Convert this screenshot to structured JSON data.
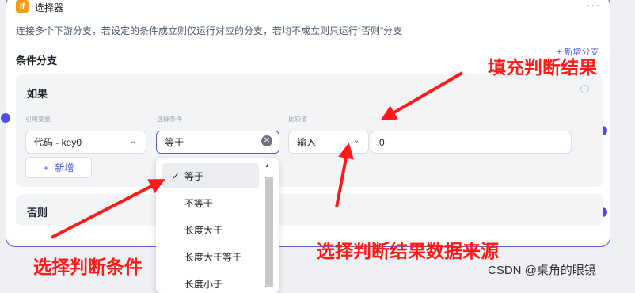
{
  "node": {
    "icon_text": "If",
    "title": "选择器",
    "more": "···",
    "description": "连接多个下游分支，若设定的条件成立则仅运行对应的分支，若均不成立则只运行“否则”分支",
    "section_title": "条件分支",
    "add_branch": "+ 新增分支"
  },
  "if_branch": {
    "label": "如果",
    "col_variable": "引用变量",
    "col_condition": "选择条件",
    "col_compare": "比较值",
    "variable_value": "代码 - key0",
    "condition_value": "等于",
    "source_value": "输入",
    "compare_value": "0",
    "add_label": "新增"
  },
  "else_branch": {
    "label": "否则"
  },
  "dropdown": {
    "options": [
      "等于",
      "不等于",
      "长度大于",
      "长度大于等于",
      "长度小于"
    ],
    "selected": "等于"
  },
  "annotations": {
    "fill_result": "填充判断结果",
    "select_condition": "选择判断条件",
    "select_source": "选择判断结果数据来源"
  },
  "watermark": "CSDN @桌角的眼镜",
  "colors": {
    "accent": "#5b5fd6",
    "port": "#4e4ee6",
    "annotation": "#ff1a1a",
    "icon_bg": "#f2a01b"
  }
}
